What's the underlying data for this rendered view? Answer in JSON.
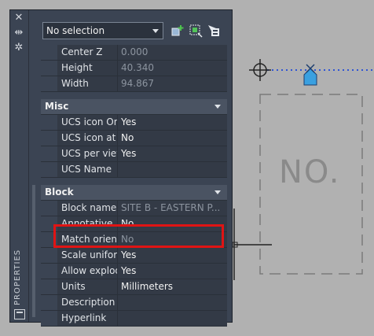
{
  "palette": {
    "title": "PROPERTIES",
    "selection": "No selection",
    "icons": [
      "close-icon",
      "pin-icon",
      "settings-icon",
      "quick-select-icon",
      "select-objects-icon",
      "toggle-pickadd-icon"
    ]
  },
  "rows_top": [
    {
      "name": "Center Z",
      "value": "0.000",
      "dim": true
    },
    {
      "name": "Height",
      "value": "40.340",
      "dim": true
    },
    {
      "name": "Width",
      "value": "94.867",
      "dim": true
    }
  ],
  "misc": {
    "title": "Misc",
    "rows": [
      {
        "name": "UCS icon On",
        "value": "Yes"
      },
      {
        "name": "UCS icon at o...",
        "value": "No"
      },
      {
        "name": "UCS per view...",
        "value": "Yes"
      },
      {
        "name": "UCS Name",
        "value": ""
      }
    ]
  },
  "block": {
    "title": "Block",
    "rows": [
      {
        "name": "Block name",
        "value": "SITE B - EASTERN P...",
        "dim": true
      },
      {
        "name": "Annotative",
        "value": "No"
      },
      {
        "name": "Match orient...",
        "value": "No",
        "dim": true
      },
      {
        "name": "Scale uniformly",
        "value": "Yes"
      },
      {
        "name": "Allow explodi...",
        "value": "Yes"
      },
      {
        "name": "Units",
        "value": "Millimeters"
      },
      {
        "name": "Description",
        "value": ""
      },
      {
        "name": "Hyperlink",
        "value": ""
      }
    ]
  },
  "drawing": {
    "block_text": "NO."
  },
  "colors": {
    "highlight": "#e01414",
    "accent": "#3aa0e0"
  }
}
